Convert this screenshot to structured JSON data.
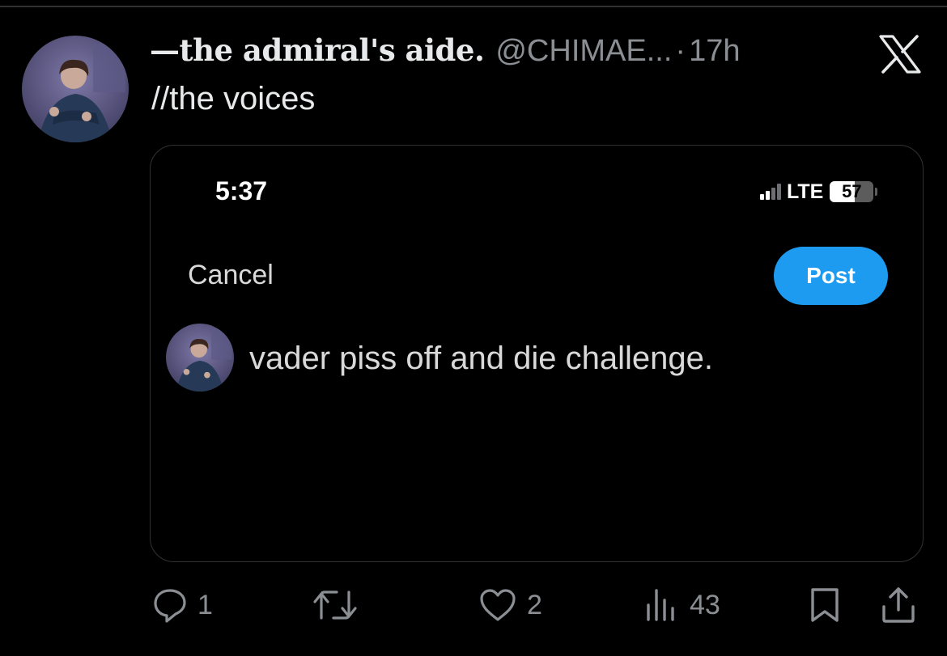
{
  "tweet": {
    "display_name": "—the admiral's aide.",
    "handle": "@CHIMAE...",
    "separator": "·",
    "time": "17h",
    "text": "//the voices"
  },
  "screenshot": {
    "status_bar": {
      "time": "5:37",
      "network": "LTE",
      "battery_percent": "57",
      "battery_level": 0.57
    },
    "compose": {
      "cancel_label": "Cancel",
      "post_label": "Post",
      "draft_text": "vader piss off and die challenge."
    }
  },
  "actions": {
    "replies": "1",
    "likes": "2",
    "views": "43"
  },
  "icons": {
    "brand": "x-logo-icon",
    "reply": "reply-icon",
    "retweet": "retweet-icon",
    "like": "heart-icon",
    "views": "views-chart-icon",
    "bookmark": "bookmark-icon",
    "share": "share-icon"
  },
  "colors": {
    "background": "#000000",
    "text": "#e7e9ea",
    "muted": "#8b8f94",
    "accent": "#1d9bf0"
  }
}
